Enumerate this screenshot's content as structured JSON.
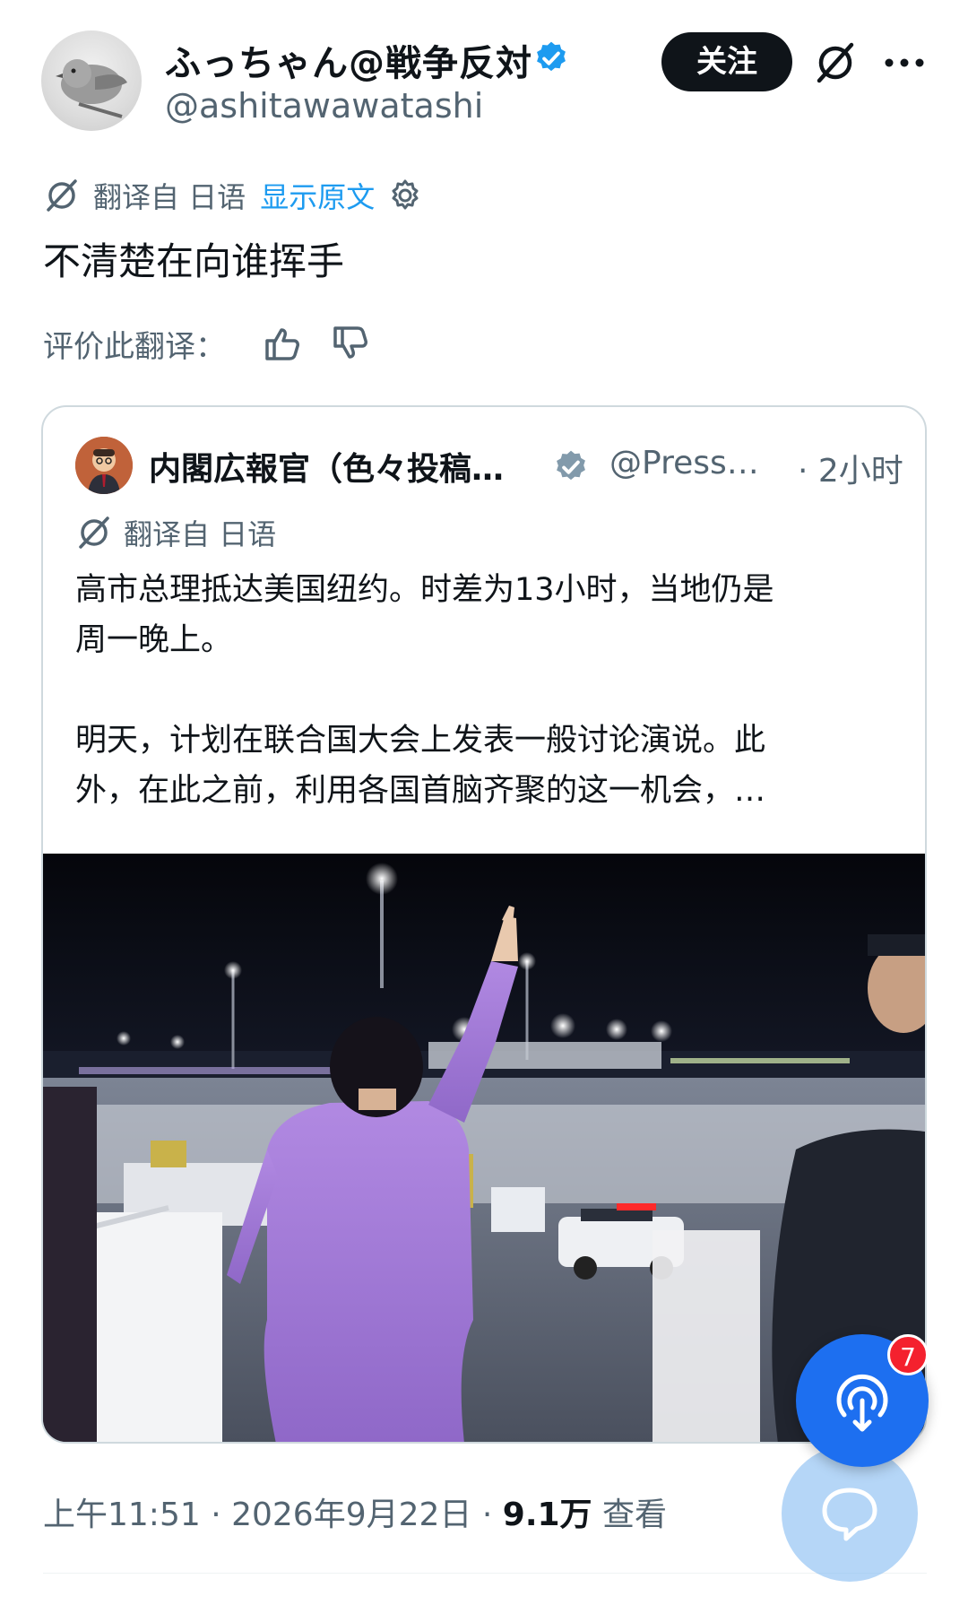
{
  "author": {
    "display_name": "ふっちゃん@戦争反対",
    "handle": "@ashitawawatashi",
    "follow_label": "关注"
  },
  "translation": {
    "translated_from": "翻译自 日语",
    "show_original": "显示原文"
  },
  "tweet": {
    "text": "不清楚在向谁挥手",
    "rate_label": "评价此翻译："
  },
  "quote": {
    "display_name": "内閣広報官（色々投稿…",
    "handle": "@Press…",
    "time": "· 2小时",
    "translated_from": "翻译自 日语",
    "line1": "高市总理抵达美国纽约。时差为13小时，当地仍是",
    "line2": "周一晚上。",
    "line3": "明天，计划在联合国大会上发表一般讨论演说。此",
    "line4": "外，在此之前，利用各国首脑齐聚的这一机会，…"
  },
  "meta": {
    "time": "上午11:51",
    "sep1": " · ",
    "date": "2026年9月22日",
    "sep2": " · ",
    "views_count": "9.1万",
    "views_label": " 查看"
  },
  "spaces": {
    "badge_count": "7"
  },
  "icons": {
    "verified": "verified-badge-icon",
    "grok": "grok-icon",
    "more": "more-dots-icon",
    "translate": "translate-icon",
    "settings": "settings-gear-icon",
    "thumb_up": "thumbs-up-icon",
    "thumb_down": "thumbs-down-icon",
    "spaces": "spaces-broadcast-icon",
    "chat": "chat-bubble-icon"
  },
  "colors": {
    "accent": "#1d9bf0",
    "text": "#0f1419",
    "muted": "#536471",
    "follow_bg": "#0f1419",
    "fab": "#1d6ff0",
    "badge": "#f4212e",
    "suit": "#a27ad6"
  }
}
